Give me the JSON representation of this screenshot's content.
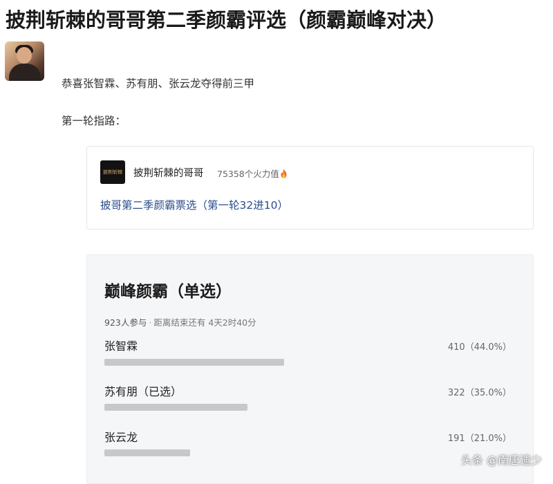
{
  "post": {
    "title": "披荆斩棘的哥哥第二季颜霸评选（颜霸巅峰对决）",
    "line1": "恭喜张智霖、苏有朋、张云龙夺得前三甲",
    "line2": "第一轮指路："
  },
  "embed": {
    "logo_text": "披荆斩棘",
    "account_name": "披荆斩棘的哥哥",
    "heat": "75358个火力值",
    "heat_icon": "flame-icon",
    "link_text": "披哥第二季颜霸票选（第一轮32进10）"
  },
  "poll": {
    "title": "巅峰颜霸（单选）",
    "participants": "923人参与",
    "separator": "·",
    "deadline": "距离结束还有 4天2时40分",
    "options": [
      {
        "label": "张智霖",
        "count": "410",
        "percent_text": "（44.0%）",
        "share": 0.44
      },
      {
        "label": "苏有朋（已选）",
        "count": "322",
        "percent_text": "（35.0%）",
        "share": 0.35
      },
      {
        "label": "张云龙",
        "count": "191",
        "percent_text": "（21.0%）",
        "share": 0.21
      }
    ],
    "bar_color": "#c8c8c8"
  },
  "watermark": "头条 @南唐遗少"
}
